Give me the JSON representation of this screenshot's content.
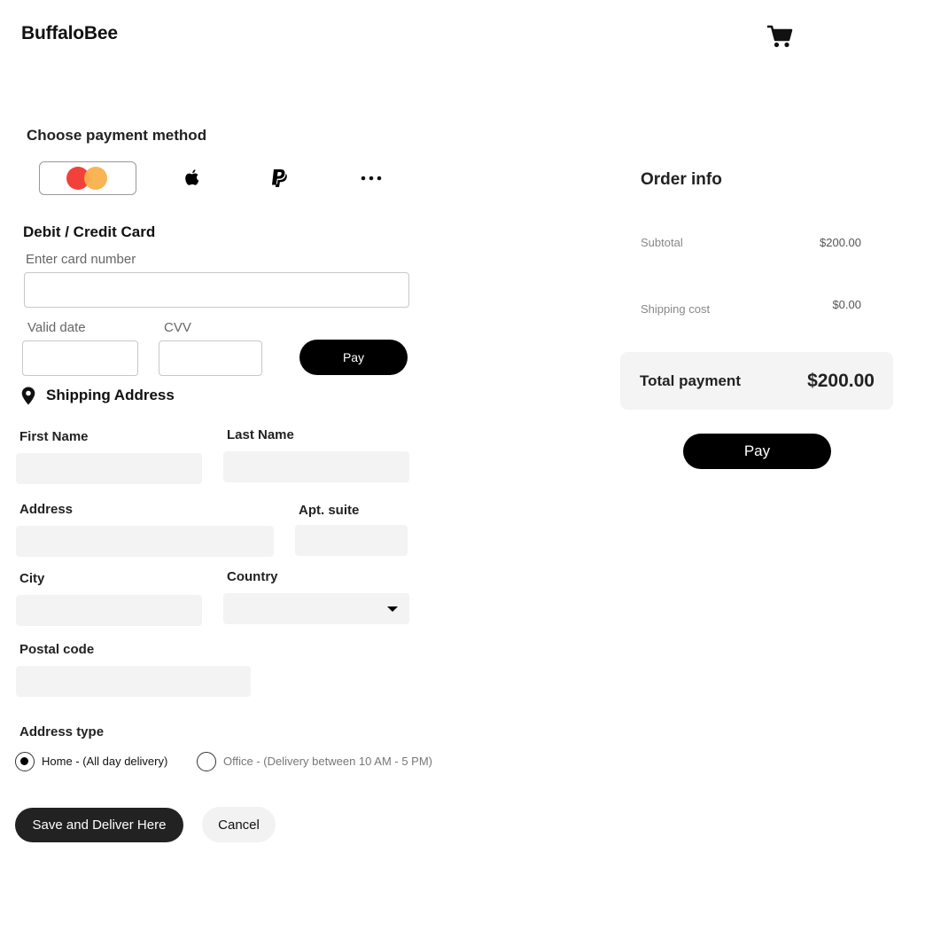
{
  "header": {
    "brand": "BuffaloBee",
    "cart_icon": "cart-icon"
  },
  "payment": {
    "title": "Choose payment method",
    "methods": [
      {
        "icon": "mastercard-icon",
        "selected": true
      },
      {
        "icon": "apple-icon",
        "selected": false
      },
      {
        "icon": "paypal-icon",
        "selected": false
      },
      {
        "icon": "more-icon",
        "selected": false
      }
    ],
    "card_section_title": "Debit / Credit Card",
    "card_number_label": "Enter card number",
    "card_number_value": "",
    "valid_date_label": "Valid date",
    "valid_date_value": "",
    "cvv_label": "CVV",
    "cvv_value": "",
    "pay_label": "Pay"
  },
  "shipping": {
    "title": "Shipping Address",
    "icon": "location-pin-icon",
    "first_name_label": "First Name",
    "first_name_value": "",
    "last_name_label": "Last Name",
    "last_name_value": "",
    "address_label": "Address",
    "address_value": "",
    "apt_label": "Apt. suite",
    "apt_value": "",
    "city_label": "City",
    "city_value": "",
    "country_label": "Country",
    "country_value": "",
    "postal_label": "Postal code",
    "postal_value": "",
    "address_type_label": "Address type",
    "address_types": [
      {
        "label": "Home - (All day delivery)",
        "selected": true
      },
      {
        "label": "Office - (Delivery between 10 AM - 5 PM)",
        "selected": false
      }
    ],
    "save_label": "Save and Deliver Here",
    "cancel_label": "Cancel"
  },
  "order": {
    "title": "Order info",
    "subtotal_label": "Subtotal",
    "subtotal_value": "$200.00",
    "shipping_label": "Shipping cost",
    "shipping_value": "$0.00",
    "total_label": "Total payment",
    "total_value": "$200.00",
    "pay_label": "Pay"
  },
  "colors": {
    "primary": "#000000",
    "mastercard_red": "#f2413a",
    "mastercard_yellow": "#f9b04b",
    "input_fill": "#f3f3f3"
  }
}
